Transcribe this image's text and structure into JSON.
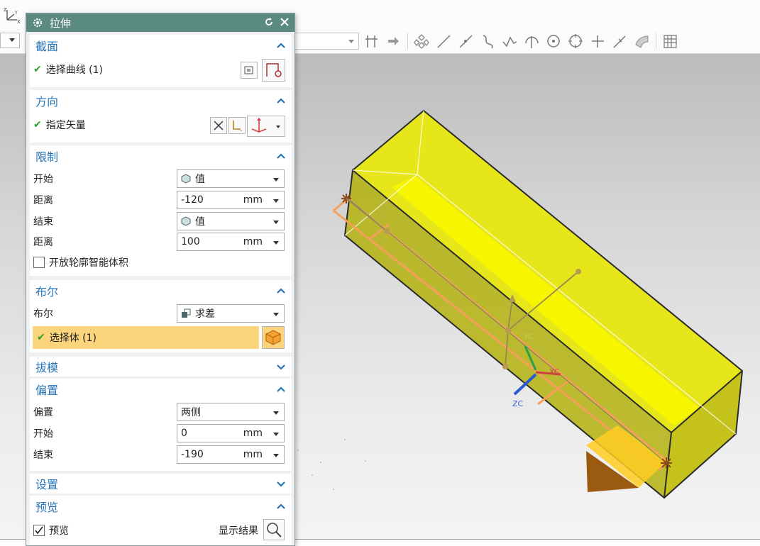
{
  "toolbar": {
    "icons": [
      "dots-icon",
      "line-icon",
      "line-icon",
      "arc-icon",
      "spline-icon",
      "arc-icon",
      "circle-icon",
      "circle-icon",
      "plus-icon",
      "line-icon",
      "blend-icon",
      "grid-icon"
    ]
  },
  "viewport": {
    "axes": {
      "yc": "YC",
      "xc": "XC",
      "zc": "ZC"
    },
    "colors": {
      "body": "#e6e61a",
      "highlight": "#f5a05a"
    }
  },
  "dialog": {
    "title": "拉伸",
    "section": {
      "title": "截面",
      "select_curve": "选择曲线 (1)"
    },
    "direction": {
      "title": "方向",
      "specify_vector": "指定矢量"
    },
    "limits": {
      "title": "限制",
      "start_label": "开始",
      "start_value": "值",
      "dist1_label": "距离",
      "dist1_value": "-120",
      "dist1_unit": "mm",
      "end_label": "结束",
      "end_value": "值",
      "dist2_label": "距离",
      "dist2_value": "100",
      "dist2_unit": "mm",
      "open_profile": "开放轮廓智能体积"
    },
    "boolean": {
      "title": "布尔",
      "bool_label": "布尔",
      "bool_value": "求差",
      "select_body": "选择体 (1)"
    },
    "draft": {
      "title": "拔模"
    },
    "offset": {
      "title": "偏置",
      "offset_label": "偏置",
      "offset_value": "两侧",
      "start_label": "开始",
      "start_value": "0",
      "start_unit": "mm",
      "end_label": "结束",
      "end_value": "-190",
      "end_unit": "mm"
    },
    "settings": {
      "title": "设置"
    },
    "preview": {
      "title": "预览",
      "preview_label": "预览",
      "preview_checked": true,
      "show_result": "显示结果"
    }
  }
}
